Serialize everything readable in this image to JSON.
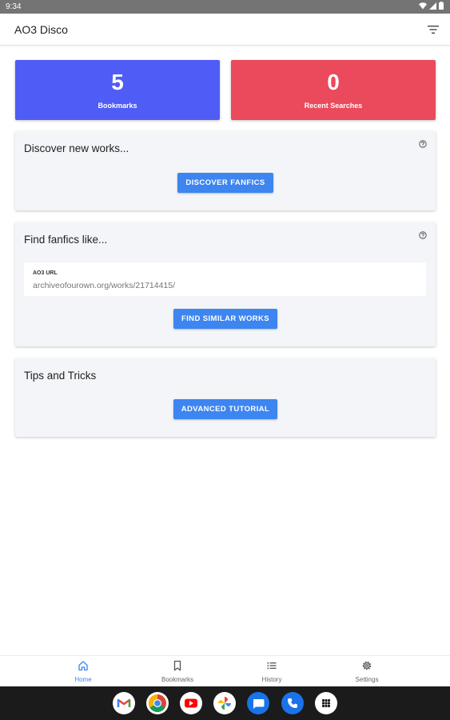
{
  "status_bar": {
    "time": "9:34"
  },
  "app_bar": {
    "title": "AO3 Disco",
    "filter_icon": "filter-icon"
  },
  "stats": {
    "bookmarks": {
      "count": "5",
      "label": "Bookmarks",
      "color": "#4f5cf6"
    },
    "recent_searches": {
      "count": "0",
      "label": "Recent Searches",
      "color": "#ea4a5c"
    }
  },
  "discover": {
    "title": "Discover new works...",
    "button_label": "DISCOVER FANFICS"
  },
  "find_like": {
    "title": "Find fanfics like...",
    "url_label": "AO3 URL",
    "url_placeholder": "archiveofourown.org/works/21714415/",
    "button_label": "FIND SIMILAR WORKS"
  },
  "tips": {
    "title": "Tips and Tricks",
    "button_label": "ADVANCED TUTORIAL"
  },
  "bottom_nav": {
    "items": [
      {
        "label": "Home",
        "icon": "home-icon",
        "active": true
      },
      {
        "label": "Bookmarks",
        "icon": "bookmark-icon",
        "active": false
      },
      {
        "label": "History",
        "icon": "list-icon",
        "active": false
      },
      {
        "label": "Settings",
        "icon": "gear-icon",
        "active": false
      }
    ],
    "active_color": "#3d85f0"
  },
  "taskbar": {
    "apps": [
      "gmail-icon",
      "chrome-icon",
      "youtube-icon",
      "photos-icon",
      "messages-icon",
      "phone-icon",
      "app-drawer-icon"
    ]
  }
}
